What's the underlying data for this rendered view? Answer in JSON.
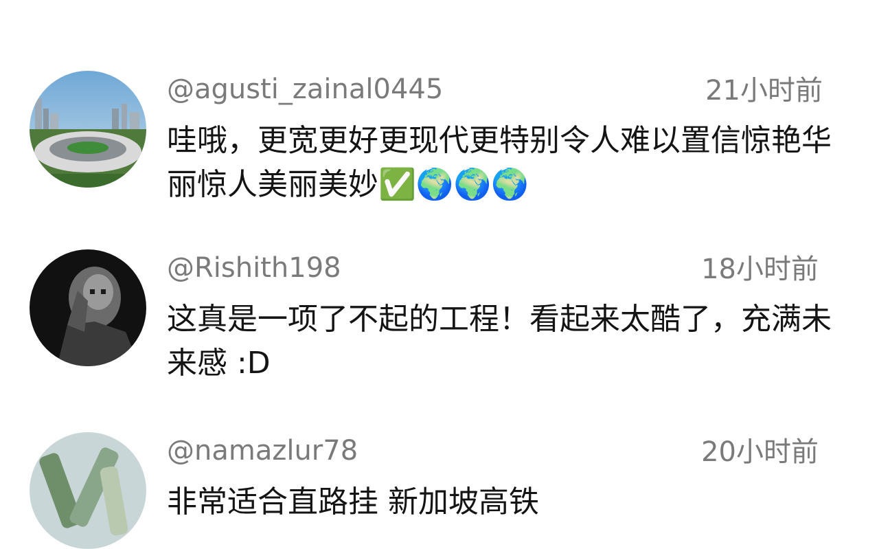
{
  "comments": [
    {
      "username": "@agusti_zainal0445",
      "time": "21小时前",
      "text": "哇哦，更宽更好更现代更特别令人难以置信惊艳华丽惊人美丽美妙✅🌍🌍🌍"
    },
    {
      "username": "@Rishith198",
      "time": "18小时前",
      "text": "这真是一项了不起的工程！看起来太酷了，充满未来感 :D"
    },
    {
      "username": "@namazlur78",
      "time": "20小时前",
      "text": "非常适合直路挂 新加坡高铁"
    }
  ],
  "colors": {
    "meta_text": "#7a7a7a",
    "body_text": "#141414",
    "background": "#ffffff"
  }
}
